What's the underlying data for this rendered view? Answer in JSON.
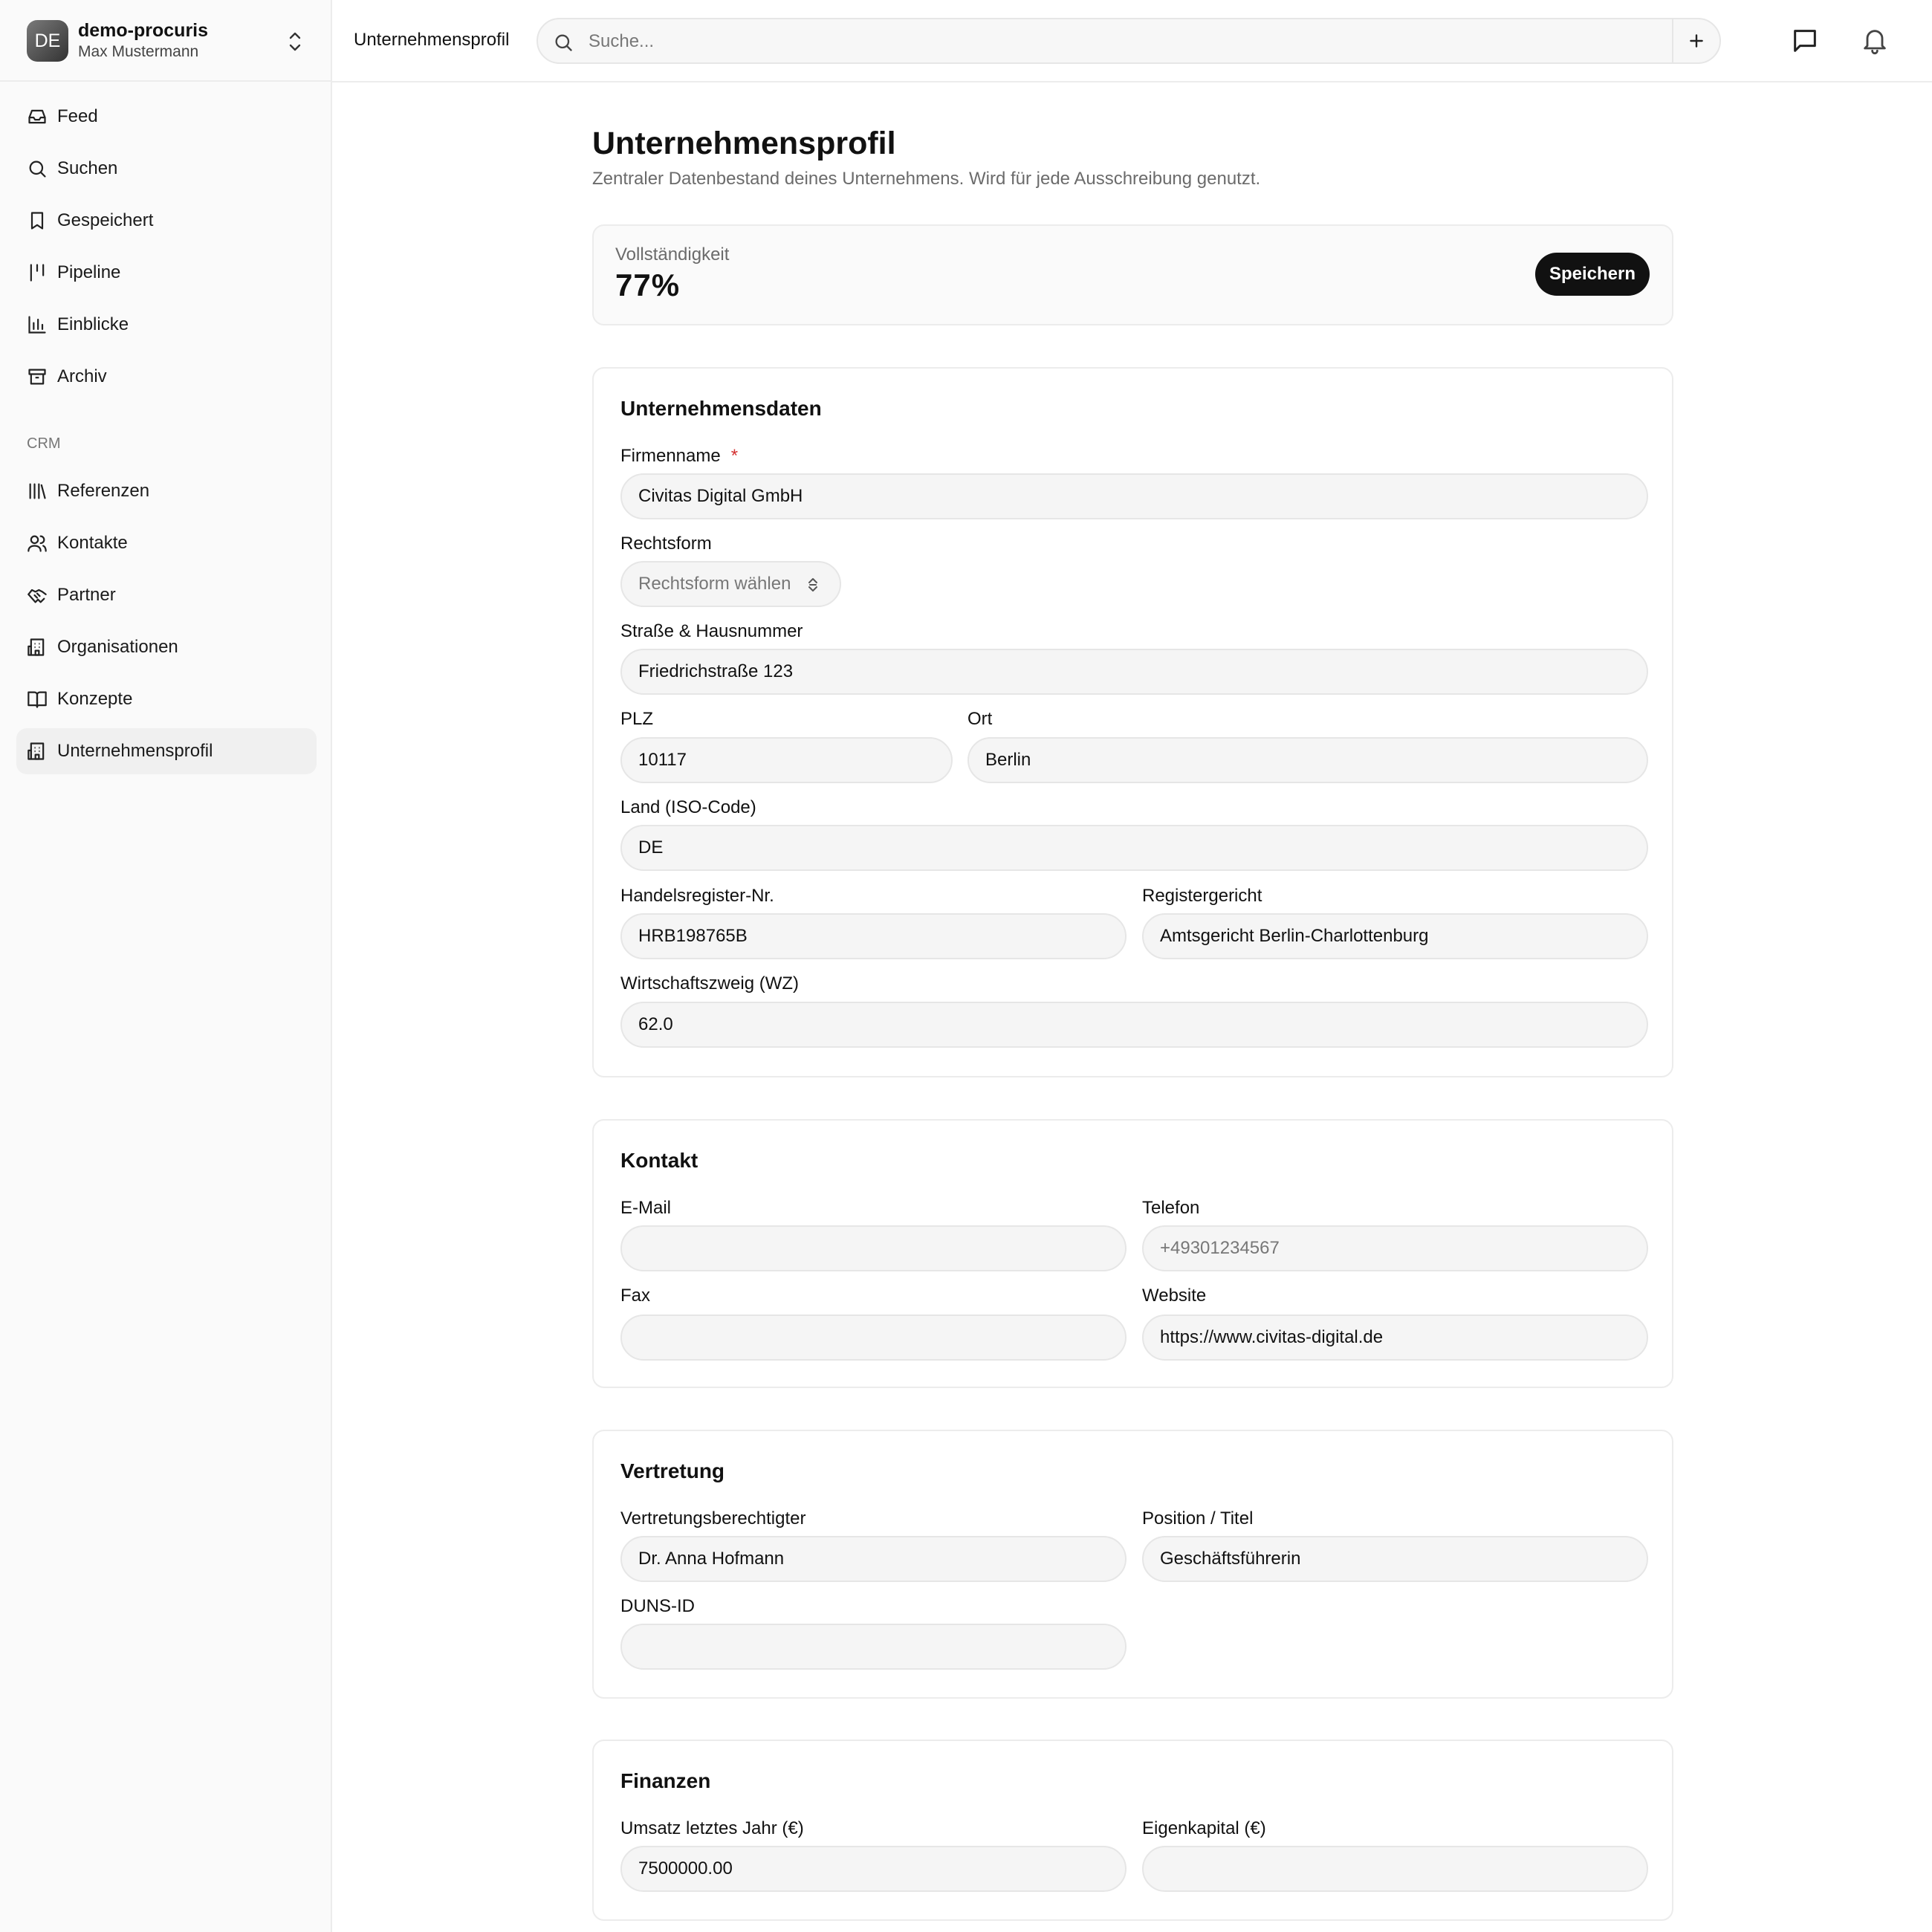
{
  "workspace": {
    "avatar_initials": "DE",
    "name": "demo-procuris",
    "user": "Max Mustermann"
  },
  "nav": {
    "items": [
      {
        "label": "Feed",
        "icon": "inbox-icon"
      },
      {
        "label": "Suchen",
        "icon": "search-icon"
      },
      {
        "label": "Gespeichert",
        "icon": "bookmark-icon"
      },
      {
        "label": "Pipeline",
        "icon": "pipeline-icon"
      },
      {
        "label": "Einblicke",
        "icon": "bar-chart-icon"
      },
      {
        "label": "Archiv",
        "icon": "archive-icon"
      }
    ],
    "section_label": "CRM",
    "crm_items": [
      {
        "label": "Referenzen",
        "icon": "library-icon"
      },
      {
        "label": "Kontakte",
        "icon": "users-icon"
      },
      {
        "label": "Partner",
        "icon": "handshake-icon"
      },
      {
        "label": "Organisationen",
        "icon": "building-icon"
      },
      {
        "label": "Konzepte",
        "icon": "book-open-icon"
      },
      {
        "label": "Unternehmensprofil",
        "icon": "building-icon",
        "active": true
      }
    ]
  },
  "topbar": {
    "breadcrumb": "Unternehmensprofil",
    "search_placeholder": "Suche..."
  },
  "page": {
    "title": "Unternehmensprofil",
    "subtitle": "Zentraler Datenbestand deines Unternehmens. Wird für jede Ausschreibung genutzt."
  },
  "completeness": {
    "label": "Vollständigkeit",
    "value": "77%",
    "save_label": "Speichern"
  },
  "company": {
    "title": "Unternehmensdaten",
    "firmenname_label": "Firmenname",
    "required_mark": "*",
    "firmenname_value": "Civitas Digital GmbH",
    "rechtsform_label": "Rechtsform",
    "rechtsform_placeholder": "Rechtsform wählen",
    "strasse_label": "Straße & Hausnummer",
    "strasse_value": "Friedrichstraße 123",
    "plz_label": "PLZ",
    "plz_value": "10117",
    "ort_label": "Ort",
    "ort_value": "Berlin",
    "land_label": "Land (ISO-Code)",
    "land_value": "DE",
    "hr_label": "Handelsregister-Nr.",
    "hr_value": "HRB198765B",
    "registergericht_label": "Registergericht",
    "registergericht_value": "Amtsgericht Berlin-Charlottenburg",
    "wz_label": "Wirtschaftszweig (WZ)",
    "wz_value": "62.0"
  },
  "contact": {
    "title": "Kontakt",
    "email_label": "E-Mail",
    "email_value": "",
    "telefon_label": "Telefon",
    "telefon_placeholder": "+49301234567",
    "fax_label": "Fax",
    "fax_value": "",
    "website_label": "Website",
    "website_value": "https://www.civitas-digital.de"
  },
  "representation": {
    "title": "Vertretung",
    "vertreter_label": "Vertretungsberechtigter",
    "vertreter_value": "Dr. Anna Hofmann",
    "position_label": "Position / Titel",
    "position_value": "Geschäftsführerin",
    "duns_label": "DUNS-ID",
    "duns_value": ""
  },
  "finance": {
    "title": "Finanzen",
    "umsatz_label": "Umsatz letztes Jahr (€)",
    "umsatz_value": "7500000.00",
    "eigenkapital_label": "Eigenkapital (€)",
    "eigenkapital_value": ""
  }
}
